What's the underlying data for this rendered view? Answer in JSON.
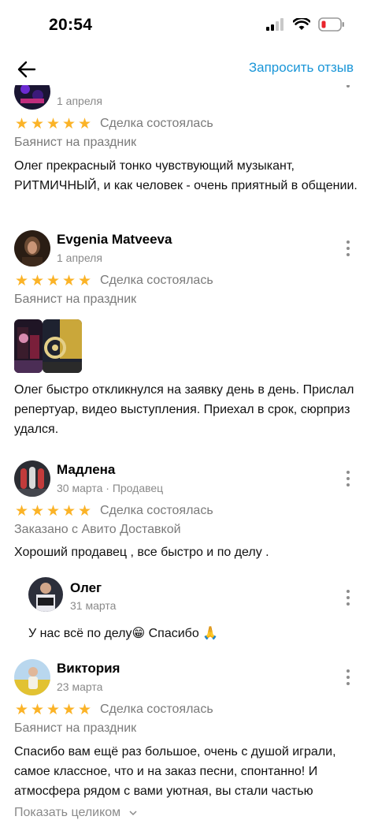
{
  "status_bar": {
    "time": "20:54",
    "icons": [
      "signal-icon",
      "wifi-icon",
      "battery-low-icon"
    ]
  },
  "nav": {
    "back_icon": "arrow-left-icon",
    "request_review": "Запросить отзыв"
  },
  "colors": {
    "accent_link": "#1a96d8",
    "star": "#fbb327",
    "muted_text": "#7a7a7a"
  },
  "reviews": [
    {
      "date": "1 апреля",
      "rating": 5,
      "status": "Сделка состоялась",
      "subject": "Баянист на праздник",
      "text": "Олег прекрасный тонко чувствующий музыкант, РИТМИЧНЫЙ, и как человек - очень приятный в общении."
    },
    {
      "author": "Evgenia Matveeva",
      "date": "1 апреля",
      "rating": 5,
      "status": "Сделка состоялась",
      "subject": "Баянист на праздник",
      "photos": 2,
      "text": "Олег быстро откликнулся на заявку день в день. Прислал репертуар, видео выступления. Приехал в срок, сюрприз удался."
    },
    {
      "author": "Мадлена",
      "date": "30 марта · Продавец",
      "rating": 5,
      "status": "Сделка состоялась",
      "subject": "Заказано с Авито Доставкой",
      "text": "Хороший продавец , все быстро и по делу .",
      "reply": {
        "author": "Олег",
        "date": "31 марта",
        "text": "У нас всё по делу😁 Спасибо 🙏"
      }
    },
    {
      "author": "Виктория",
      "date": "23 марта",
      "rating": 5,
      "status": "Сделка состоялась",
      "subject": "Баянист на праздник",
      "text": "Спасибо вам ещё раз большое, очень с душой играли, самое классное, что и на заказ песни, спонтанно!  И атмосфера рядом с вами уютная, вы стали частью",
      "show_more": "Показать целиком"
    }
  ]
}
